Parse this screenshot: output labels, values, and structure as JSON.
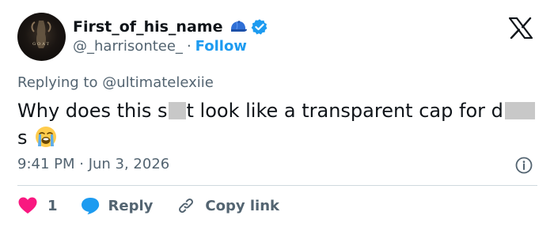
{
  "author": {
    "display_name": "First_of_his_name",
    "handle": "@_harrisontee_",
    "separator": "·",
    "follow_label": "Follow",
    "avatar_text": "GOAT"
  },
  "reply_context": {
    "prefix": "Replying to",
    "mention": "@ultimatelexiie"
  },
  "tweet": {
    "text_part1": "Why does this s",
    "text_part2": "t look like a transparent cap for d",
    "text_part3": "s",
    "emoji_name": "loudly-crying-face",
    "timestamp": "9:41 PM · Jun 3, 2026"
  },
  "actions": {
    "like_count": "1",
    "reply_label": "Reply",
    "copy_link_label": "Copy link"
  },
  "colors": {
    "accent": "#1d9bf0",
    "heart": "#f91880",
    "secondary_text": "#536471",
    "primary_text": "#0f1419"
  }
}
